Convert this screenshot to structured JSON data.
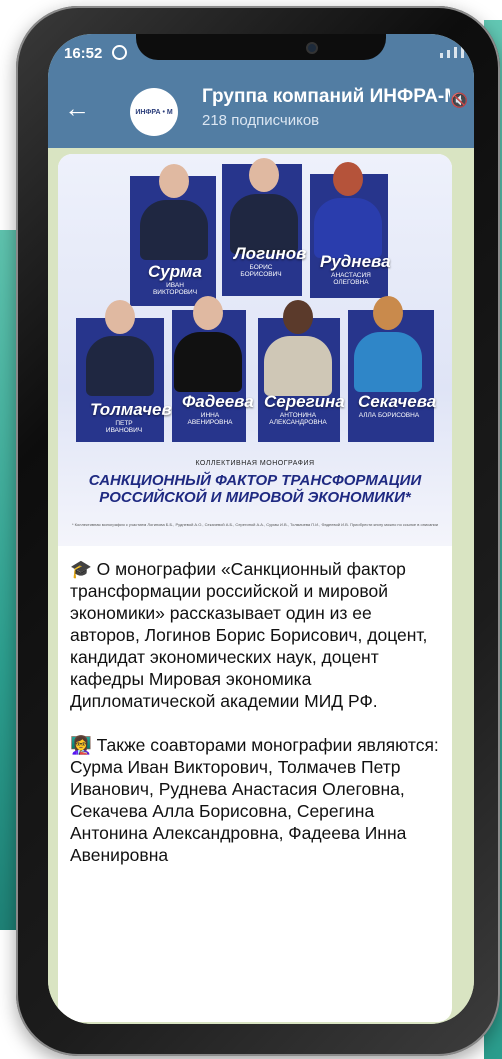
{
  "status": {
    "time": "16:52"
  },
  "channel": {
    "name": "Группа компаний ИНФРА-М",
    "subscribers": "218 подписчиков",
    "avatar_text": "ИНФРА • М"
  },
  "post_image": {
    "people": [
      {
        "name": "Сурма",
        "initials": "ИВАН ВИКТОРОВИЧ"
      },
      {
        "name": "Логинов",
        "initials": "БОРИС БОРИСОВИЧ"
      },
      {
        "name": "Руднева",
        "initials": "АНАСТАСИЯ ОЛЕГОВНА"
      },
      {
        "name": "Толмачев",
        "initials": "ПЕТР ИВАНОВИЧ"
      },
      {
        "name": "Фадеева",
        "initials": "ИННА АВЕНИРОВНА"
      },
      {
        "name": "Серегина",
        "initials": "АНТОНИНА АЛЕКСАНДРОВНА"
      },
      {
        "name": "Секачева",
        "initials": "АЛЛА БОРИСОВНА"
      }
    ],
    "kind": "КОЛЛЕКТИВНАЯ МОНОГРАФИЯ",
    "title": "САНКЦИОННЫЙ ФАКТОР ТРАНСФОРМАЦИИ РОССИЙСКОЙ И МИРОВОЙ ЭКОНОМИКИ*",
    "footnote": "* Коллективная монография с участием Логинова Б.Б., Рудневой А.О., Секачевой А.Б., Серегиной А.А., Сурмы И.В., Толмачева П.И., Фадеевой И.В. Приобрести книгу можно по ссылке в описании"
  },
  "post": {
    "paragraph1": "🎓 О монографии «Санкционный фактор трансформации российской и мировой экономики» рассказывает один из ее авторов, Логинов Борис Борисович, доцент, кандидат экономических наук, доцент кафедры Мировая экономика Дипломатической академии МИД РФ.",
    "paragraph2": "👩‍🏫 Также соавторами монографии являются: Сурма Иван Викторович, Толмачев Петр Иванович, Руднева Анастасия Олеговна, Секачева Алла Борисовна, Серегина Антонина Александровна, Фадеева Инна Авенировна"
  }
}
